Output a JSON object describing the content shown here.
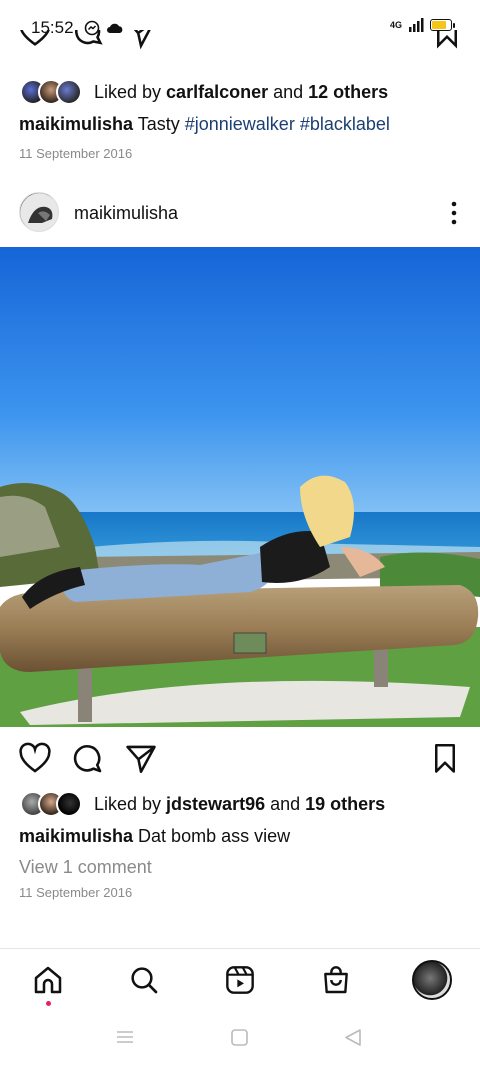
{
  "status_bar": {
    "time": "15:52",
    "network": "4G",
    "icons_left": [
      "messenger-icon",
      "cloud-icon"
    ],
    "icons_right": [
      "signal-icon",
      "battery-icon"
    ],
    "battery_color": "#f5c518"
  },
  "previous_post": {
    "liked_by_prefix": "Liked by ",
    "liked_by_user": "carlfalconer",
    "liked_by_joiner": " and ",
    "liked_by_others": "12 others",
    "caption_user": "maikimulisha",
    "caption_text": " Tasty ",
    "hashtags": [
      "#jonniewalker",
      "#blacklabel"
    ],
    "date": "11 September 2016"
  },
  "post": {
    "username": "maikimulisha",
    "liked_by_prefix": "Liked by ",
    "liked_by_user": "jdstewart96",
    "liked_by_joiner": " and ",
    "liked_by_others": "19 others",
    "caption_user": "maikimulisha",
    "caption_text": " Dat bomb ass view",
    "view_comments": "View 1 comment",
    "date": "11 September 2016"
  },
  "bottom_nav": {
    "items": [
      "home-icon",
      "search-icon",
      "reels-icon",
      "shop-icon",
      "profile-avatar"
    ],
    "active": "home",
    "notification_dot_color": "#e0245e"
  },
  "colors": {
    "hashtag": "#1c3f73",
    "muted": "#8a8a8a",
    "sky": "#1e78e6"
  }
}
